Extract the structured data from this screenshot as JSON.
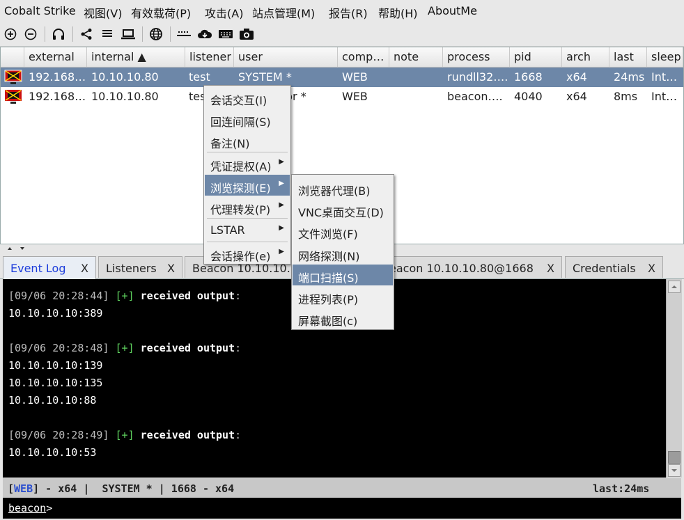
{
  "menubar": [
    "Cobalt Strike",
    "视图(V)",
    "有效载荷(P)",
    "攻击(A)",
    "站点管理(M)",
    "报告(R)",
    "帮助(H)",
    "AboutMe"
  ],
  "toolbar": [
    "plus-circle-icon",
    "minus-circle-icon",
    "headphones-icon",
    "share-icon",
    "list-icon",
    "laptop-icon",
    "globe-icon",
    "dots-icon",
    "cloud-download-icon",
    "keyboard-icon",
    "camera-icon"
  ],
  "table": {
    "headers": [
      "external",
      "internal ▲",
      "listener",
      "user",
      "comp…",
      "note",
      "process",
      "pid",
      "arch",
      "last",
      "sleep"
    ],
    "rows": [
      {
        "external": "192.168…",
        "internal": "10.10.10.80",
        "listener": "test",
        "user": "SYSTEM *",
        "computer": "WEB",
        "note": "",
        "process": "rundll32….",
        "pid": "1668",
        "arch": "x64",
        "last": "24ms",
        "sleep": "Int…"
      },
      {
        "external": "192.168…",
        "internal": "10.10.10.80",
        "listener": "tes",
        "user": "strator *",
        "computer": "WEB",
        "note": "",
        "process": "beacon….",
        "pid": "4040",
        "arch": "x64",
        "last": "8ms",
        "sleep": "Int…"
      }
    ]
  },
  "context_menu": {
    "items": [
      "会话交互(I)",
      "回连间隔(S)",
      "备注(N)",
      "凭证提权(A)",
      "浏览探测(E)",
      "代理转发(P)",
      "LSTAR",
      "会话操作(e)"
    ]
  },
  "submenu": {
    "items": [
      "浏览器代理(B)",
      "VNC桌面交互(D)",
      "文件浏览(F)",
      "网络探测(N)",
      "端口扫描(S)",
      "进程列表(P)",
      "屏幕截图(c)"
    ]
  },
  "tabs": [
    {
      "label": "Event Log",
      "close": "X"
    },
    {
      "label": "Listeners",
      "close": "X"
    },
    {
      "label": "Beacon 10.10.10.",
      "close": ""
    },
    {
      "label": "eacon 10.10.10.80@1668",
      "close": "X"
    },
    {
      "label": "Credentials",
      "close": "X"
    }
  ],
  "console": {
    "lines": [
      {
        "ts": "[09/06 20:28:44]",
        "plus": "[+]",
        "msg": "received output",
        "colon": ":"
      },
      {
        "text": "10.10.10.10:389"
      },
      {
        "ts": "[09/06 20:28:48]",
        "plus": "[+]",
        "msg": "received output",
        "colon": ":"
      },
      {
        "text": "10.10.10.10:139"
      },
      {
        "text": "10.10.10.10:135"
      },
      {
        "text": "10.10.10.10:88"
      },
      {
        "ts": "[09/06 20:28:49]",
        "plus": "[+]",
        "msg": "received output",
        "colon": ":"
      },
      {
        "text": "10.10.10.10:53"
      }
    ]
  },
  "statusbar": {
    "open": "[",
    "computer": "WEB",
    "rest": "] - x64 |  SYSTEM * | 1668 - x64",
    "last": "last:24ms"
  },
  "prompt": {
    "label": "beacon",
    "caret": ">"
  },
  "colors": {
    "selection": "#6d87a8",
    "active_tab_text": "#1d3ddb",
    "console_bg": "#000000",
    "plus_green": "#5fd35f"
  }
}
